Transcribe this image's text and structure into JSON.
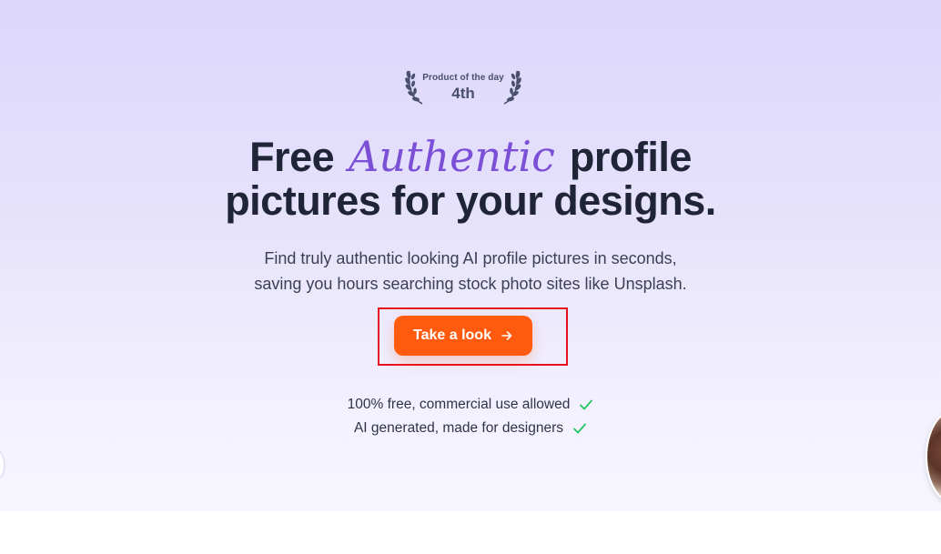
{
  "badge": {
    "caption": "Product of the day",
    "rank": "4th"
  },
  "hero": {
    "headline_word_1": "Free",
    "headline_script_word": "Authentic",
    "headline_word_2": "profile",
    "headline_line_2": "pictures for your designs.",
    "subtitle_line_1": "Find truly authentic looking AI profile pictures in seconds,",
    "subtitle_line_2": "saving you hours searching stock photo sites like Unsplash."
  },
  "cta": {
    "label": "Take a look",
    "icon": "arrow-right-icon"
  },
  "features": [
    {
      "text": "100% free, commercial use allowed",
      "icon": "check-icon"
    },
    {
      "text": "AI generated, made for designers",
      "icon": "check-icon"
    }
  ],
  "colors": {
    "cta_background": "#ff5a0d",
    "script_accent": "#7b4fd6",
    "check_green": "#22c55e",
    "highlight_border": "#e8121c",
    "headline_text": "#1f2436"
  }
}
